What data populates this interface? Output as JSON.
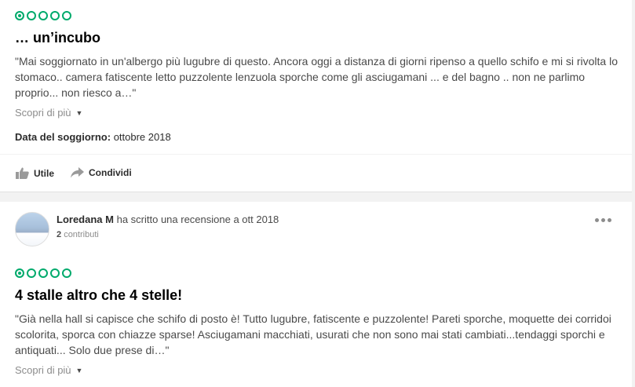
{
  "reviews": [
    {
      "rating": 1,
      "rating_max": 5,
      "title": "… un’incubo",
      "text": "\"Mai soggiornato in un'albergo più lugubre di questo. Ancora oggi a distanza di giorni ripenso a quello schifo e mi si rivolta lo stomaco.. camera fatiscente letto puzzolente lenzuola sporche come gli asciugamani ... e del bagno .. non ne parlimo proprio... non riesco a…\"",
      "more_label": "Scopri di più",
      "stay_label": "Data del soggiorno:",
      "stay_value": "ottobre 2018",
      "actions": {
        "useful": "Utile",
        "share": "Condividi"
      }
    },
    {
      "author": "Loredana M",
      "author_action": "ha scritto una recensione a ott 2018",
      "contributions_count": "2",
      "contributions_label": "contributi",
      "rating": 1,
      "rating_max": 5,
      "title": "4 stalle altro che 4 stelle!",
      "text": "\"Già nella hall si capisce che schifo di posto è! Tutto lugubre, fatiscente e puzzolente! Pareti sporche, moquette dei corridoi scolorita, sporca con chiazze sparse! Asciugamani macchiati, usurati che non sono mai stati cambiati...tendaggi sporchi e antiquati... Solo due prese di…\"",
      "more_label": "Scopri di più"
    }
  ],
  "colors": {
    "rating_green": "#00aa6c",
    "background": "#f2f2f2"
  },
  "icons": {
    "useful": "thumbs-up-icon",
    "share": "share-arrow-icon",
    "more_options": "ellipsis-icon",
    "expand": "chevron-down-icon"
  }
}
